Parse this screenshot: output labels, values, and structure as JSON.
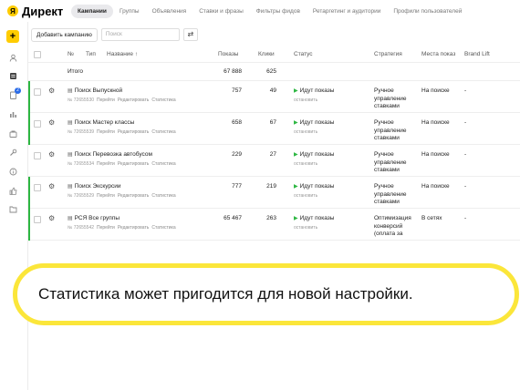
{
  "app": {
    "logo_glyph": "Я",
    "title": "Директ"
  },
  "tabs": [
    {
      "label": "Кампании",
      "active": true
    },
    {
      "label": "Группы",
      "active": false
    },
    {
      "label": "Объявления",
      "active": false
    },
    {
      "label": "Ставки и фразы",
      "active": false
    },
    {
      "label": "Фильтры фидов",
      "active": false
    },
    {
      "label": "Ретаргетинг и аудитории",
      "active": false
    },
    {
      "label": "Профили пользователей",
      "active": false
    }
  ],
  "rail": {
    "plus": "+",
    "badge": "2",
    "icons": [
      "user-icon",
      "campaigns-icon",
      "notifications-icon",
      "stats-icon",
      "bag-icon",
      "wrench-icon",
      "info-icon",
      "thumb-icon",
      "folder-icon"
    ]
  },
  "toolbar": {
    "add_label": "Добавить кампанию",
    "search_placeholder": "Поиск",
    "filter_glyph": "⇄"
  },
  "columns": {
    "no": "№",
    "type": "Тип",
    "name": "Название ↑",
    "shows": "Показы",
    "clicks": "Клики",
    "status": "Статус",
    "strategy": "Стратегия",
    "placement": "Места показ",
    "brandlift": "Brand Lift"
  },
  "totals": {
    "label": "Итого",
    "shows": "67 888",
    "clicks": "625"
  },
  "row_links": {
    "go": "Перейти",
    "edit": "Редактировать",
    "stats": "Статистика"
  },
  "campaigns": [
    {
      "name": "Поиск Выпускной",
      "id": "№ 72655530",
      "shows": "757",
      "clicks": "49",
      "status": "Идут показы",
      "status_action": "остановить",
      "strategy": [
        "Ручное",
        "управление",
        "ставками"
      ],
      "placement": "На поиске",
      "brandlift": "-"
    },
    {
      "name": "Поиск Мастер классы",
      "id": "№ 72655539",
      "shows": "658",
      "clicks": "67",
      "status": "Идут показы",
      "status_action": "остановить",
      "strategy": [
        "Ручное",
        "управление",
        "ставками"
      ],
      "placement": "На поиске",
      "brandlift": "-"
    },
    {
      "name": "Поиск Перевозка автобусом",
      "id": "№ 72655534",
      "shows": "229",
      "clicks": "27",
      "status": "Идут показы",
      "status_action": "остановить",
      "strategy": [
        "Ручное",
        "управление",
        "ставками"
      ],
      "placement": "На поиске",
      "brandlift": "-"
    },
    {
      "name": "Поиск Экскурсии",
      "id": "№ 72655529",
      "shows": "777",
      "clicks": "219",
      "status": "Идут показы",
      "status_action": "остановить",
      "strategy": [
        "Ручное",
        "управление",
        "ставками"
      ],
      "placement": "На поиске",
      "brandlift": "-"
    },
    {
      "name": "РСЯ Все группы",
      "id": "№ 72655542",
      "shows": "65 467",
      "clicks": "263",
      "status": "Идут показы",
      "status_action": "остановить",
      "strategy": [
        "Оптимизация",
        "конверсий",
        "(оплата за"
      ],
      "placement": "В сетях",
      "brandlift": "-"
    }
  ],
  "callout": {
    "text": "Статистика может пригодится для новой настройки."
  },
  "colors": {
    "brand": "#ffcc00",
    "active_green": "#2db742",
    "callout_border": "#fbe63a",
    "badge_blue": "#2a6be8"
  }
}
